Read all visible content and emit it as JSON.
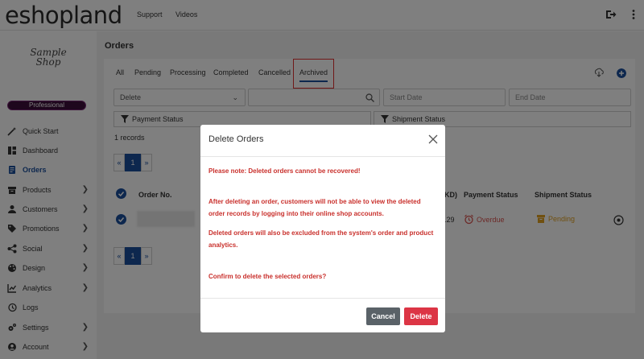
{
  "topbar": {
    "logo": "eshopland",
    "links": [
      "Support",
      "Videos"
    ]
  },
  "sidebar": {
    "shop_logo": "Sample Shop",
    "plan": "Professional",
    "items": [
      {
        "label": "Quick Start",
        "icon": "wand-icon"
      },
      {
        "label": "Dashboard",
        "icon": "dashboard-icon"
      },
      {
        "label": "Orders",
        "icon": "orders-icon"
      },
      {
        "label": "Products",
        "icon": "box-icon"
      },
      {
        "label": "Customers",
        "icon": "user-icon"
      },
      {
        "label": "Promotions",
        "icon": "tag-icon"
      },
      {
        "label": "Social",
        "icon": "share-icon"
      },
      {
        "label": "Design",
        "icon": "palette-icon"
      },
      {
        "label": "Analytics",
        "icon": "chart-icon"
      },
      {
        "label": "Logs",
        "icon": "history-icon"
      },
      {
        "label": "Settings",
        "icon": "gears-icon"
      },
      {
        "label": "Account",
        "icon": "account-icon"
      }
    ]
  },
  "main": {
    "title": "Orders",
    "tabs": [
      "All",
      "Pending",
      "Processing",
      "Completed",
      "Cancelled",
      "Archived"
    ],
    "active_tab": "Archived",
    "action_select": "Delete",
    "search_value": "",
    "start_date_placeholder": "Start Date",
    "end_date_placeholder": "End Date",
    "payment_filter": "Payment Status",
    "shipment_filter": "Shipment Status",
    "records": "1 records",
    "pager": {
      "prev": "«",
      "current": "1",
      "next": "»"
    },
    "table": {
      "headers": [
        "Order No.",
        "KD)",
        "Payment Status",
        "Shipment Status"
      ],
      "row": {
        "amount_partial": ".29",
        "payment_status": "Overdue",
        "shipment_status": "Pending"
      }
    }
  },
  "modal": {
    "title": "Delete Orders",
    "lines": [
      "Please note: Deleted orders cannot be recovered!",
      "After deleting an order, customers will not be able to view the deleted order records by logging into their online shop accounts.",
      "Deleted orders will also be excluded from the system's order and product analytics.",
      "Confirm to delete the selected orders?"
    ],
    "cancel_label": "Cancel",
    "delete_label": "Delete"
  },
  "colors": {
    "brand_blue": "#1a4e9c",
    "warning_red": "#c9302c",
    "delete_button": "#dc3545",
    "cancel_button": "#5a6268",
    "overdue": "#d9534f",
    "pending": "#e0a020",
    "plan_badge": "#3d0f3a"
  }
}
